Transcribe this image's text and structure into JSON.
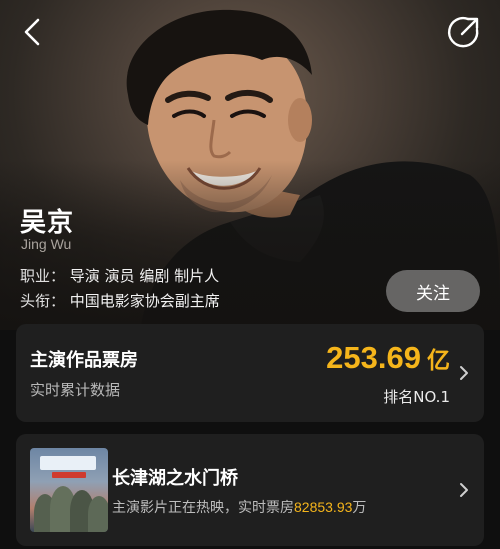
{
  "actor": {
    "name": "吴京",
    "name_en": "Jing Wu",
    "profession_label": "职业：",
    "profession_value": "导演 演员 编剧 制片人",
    "title_label": "头衔：",
    "title_value": "中国电影家协会副主席"
  },
  "header": {
    "follow_label": "关注",
    "back_icon": "back-arrow-icon",
    "share_icon": "share-icon"
  },
  "box_office": {
    "title": "主演作品票房",
    "subtitle": "实时累计数据",
    "value": "253.69",
    "unit": "亿",
    "rank": "排名NO.1"
  },
  "movie": {
    "title": "长津湖之水门桥",
    "subtitle_prefix": "主演影片正在热映，实时票房",
    "box_value": "82853.93",
    "box_unit": "万"
  },
  "colors": {
    "accent": "#f5b51b",
    "card_bg": "#1f1f1f",
    "page_bg": "#0f0f0f"
  }
}
